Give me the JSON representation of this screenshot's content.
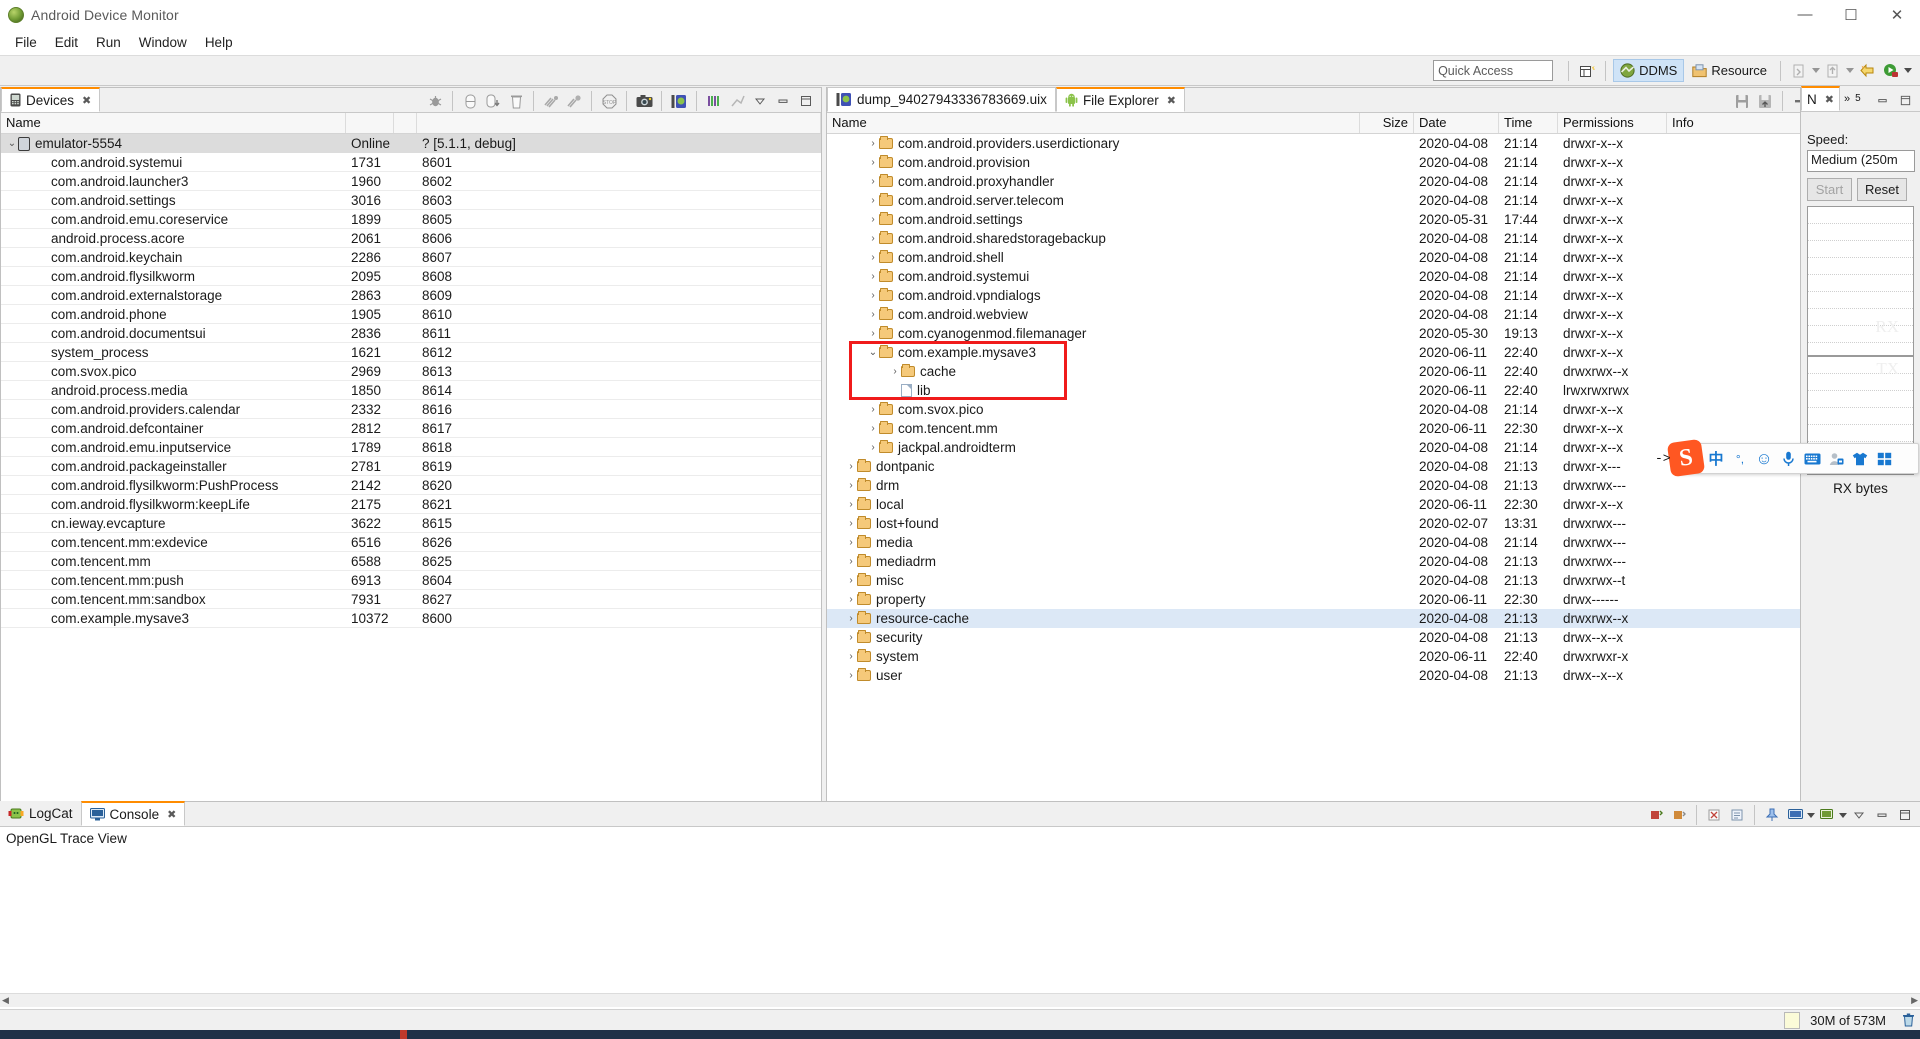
{
  "window": {
    "title": "Android Device Monitor",
    "icon": "android-logo-icon",
    "minimize": "—",
    "maximize": "☐",
    "close": "✕"
  },
  "menu": [
    "File",
    "Edit",
    "Run",
    "Window",
    "Help"
  ],
  "toolbar": {
    "quick_access_placeholder": "Quick Access",
    "new_perspective_icon": "new-perspective-icon",
    "perspectives": [
      {
        "label": "DDMS",
        "icon": "ddms-icon",
        "active": true
      },
      {
        "label": "Resource",
        "icon": "resource-icon",
        "active": false
      }
    ],
    "extra_icons": [
      "import-icon",
      "export-icon",
      "new-icon",
      "run-icon"
    ]
  },
  "devices_panel": {
    "tab": {
      "label": "Devices",
      "icon": "device-icon",
      "close": "✖"
    },
    "tools": [
      "debug-icon",
      "heap-icon",
      "heap-update-icon",
      "gc-icon",
      "threads-icon",
      "method-profiling-icon",
      "stop-icon",
      "screen-capture-icon",
      "device-dump-icon",
      "systrace-icon",
      "hierarchy-icon",
      "view-menu-icon",
      "minimize-icon",
      "maximize-icon"
    ],
    "columns": [
      "Name",
      "",
      "",
      ""
    ],
    "device": {
      "name": "emulator-5554",
      "status": "Online",
      "version": "? [5.1.1, debug]"
    },
    "processes": [
      {
        "name": "com.android.systemui",
        "pid": "1731",
        "port": "8601"
      },
      {
        "name": "com.android.launcher3",
        "pid": "1960",
        "port": "8602"
      },
      {
        "name": "com.android.settings",
        "pid": "3016",
        "port": "8603"
      },
      {
        "name": "com.android.emu.coreservice",
        "pid": "1899",
        "port": "8605"
      },
      {
        "name": "android.process.acore",
        "pid": "2061",
        "port": "8606"
      },
      {
        "name": "com.android.keychain",
        "pid": "2286",
        "port": "8607"
      },
      {
        "name": "com.android.flysilkworm",
        "pid": "2095",
        "port": "8608"
      },
      {
        "name": "com.android.externalstorage",
        "pid": "2863",
        "port": "8609"
      },
      {
        "name": "com.android.phone",
        "pid": "1905",
        "port": "8610"
      },
      {
        "name": "com.android.documentsui",
        "pid": "2836",
        "port": "8611"
      },
      {
        "name": "system_process",
        "pid": "1621",
        "port": "8612"
      },
      {
        "name": "com.svox.pico",
        "pid": "2969",
        "port": "8613"
      },
      {
        "name": "android.process.media",
        "pid": "1850",
        "port": "8614"
      },
      {
        "name": "com.android.providers.calendar",
        "pid": "2332",
        "port": "8616"
      },
      {
        "name": "com.android.defcontainer",
        "pid": "2812",
        "port": "8617"
      },
      {
        "name": "com.android.emu.inputservice",
        "pid": "1789",
        "port": "8618"
      },
      {
        "name": "com.android.packageinstaller",
        "pid": "2781",
        "port": "8619"
      },
      {
        "name": "com.android.flysilkworm:PushProcess",
        "pid": "2142",
        "port": "8620"
      },
      {
        "name": "com.android.flysilkworm:keepLife",
        "pid": "2175",
        "port": "8621"
      },
      {
        "name": "cn.ieway.evcapture",
        "pid": "3622",
        "port": "8615"
      },
      {
        "name": "com.tencent.mm:exdevice",
        "pid": "6516",
        "port": "8626"
      },
      {
        "name": "com.tencent.mm",
        "pid": "6588",
        "port": "8625"
      },
      {
        "name": "com.tencent.mm:push",
        "pid": "6913",
        "port": "8604"
      },
      {
        "name": "com.tencent.mm:sandbox",
        "pid": "7931",
        "port": "8627"
      },
      {
        "name": "com.example.mysave3",
        "pid": "10372",
        "port": "8600"
      }
    ]
  },
  "editor_tabs": [
    {
      "label": "dump_94027943336783669.uix",
      "icon": "uix-file-icon",
      "active": false,
      "close": ""
    },
    {
      "label": "File Explorer",
      "icon": "android-robot-icon",
      "active": true,
      "close": "✖"
    }
  ],
  "file_explorer": {
    "tools": [
      "pull-file-icon",
      "push-file-icon",
      "delete-icon",
      "new-folder-icon",
      "view-menu-icon",
      "minimize-icon",
      "maximize-icon"
    ],
    "columns": [
      "Name",
      "Size",
      "Date",
      "Time",
      "Permissions",
      "Info"
    ],
    "rows": [
      {
        "indent": 1,
        "twisty": "›",
        "icon": "folder",
        "name": "com.android.providers.userdictionary",
        "size": "",
        "date": "2020-04-08",
        "time": "21:14",
        "perm": "drwxr-x--x",
        "info": "",
        "selected": false
      },
      {
        "indent": 1,
        "twisty": "›",
        "icon": "folder",
        "name": "com.android.provision",
        "size": "",
        "date": "2020-04-08",
        "time": "21:14",
        "perm": "drwxr-x--x",
        "info": "",
        "selected": false
      },
      {
        "indent": 1,
        "twisty": "›",
        "icon": "folder",
        "name": "com.android.proxyhandler",
        "size": "",
        "date": "2020-04-08",
        "time": "21:14",
        "perm": "drwxr-x--x",
        "info": "",
        "selected": false
      },
      {
        "indent": 1,
        "twisty": "›",
        "icon": "folder",
        "name": "com.android.server.telecom",
        "size": "",
        "date": "2020-04-08",
        "time": "21:14",
        "perm": "drwxr-x--x",
        "info": "",
        "selected": false
      },
      {
        "indent": 1,
        "twisty": "›",
        "icon": "folder",
        "name": "com.android.settings",
        "size": "",
        "date": "2020-05-31",
        "time": "17:44",
        "perm": "drwxr-x--x",
        "info": "",
        "selected": false
      },
      {
        "indent": 1,
        "twisty": "›",
        "icon": "folder",
        "name": "com.android.sharedstoragebackup",
        "size": "",
        "date": "2020-04-08",
        "time": "21:14",
        "perm": "drwxr-x--x",
        "info": "",
        "selected": false
      },
      {
        "indent": 1,
        "twisty": "›",
        "icon": "folder",
        "name": "com.android.shell",
        "size": "",
        "date": "2020-04-08",
        "time": "21:14",
        "perm": "drwxr-x--x",
        "info": "",
        "selected": false
      },
      {
        "indent": 1,
        "twisty": "›",
        "icon": "folder",
        "name": "com.android.systemui",
        "size": "",
        "date": "2020-04-08",
        "time": "21:14",
        "perm": "drwxr-x--x",
        "info": "",
        "selected": false
      },
      {
        "indent": 1,
        "twisty": "›",
        "icon": "folder",
        "name": "com.android.vpndialogs",
        "size": "",
        "date": "2020-04-08",
        "time": "21:14",
        "perm": "drwxr-x--x",
        "info": "",
        "selected": false
      },
      {
        "indent": 1,
        "twisty": "›",
        "icon": "folder",
        "name": "com.android.webview",
        "size": "",
        "date": "2020-04-08",
        "time": "21:14",
        "perm": "drwxr-x--x",
        "info": "",
        "selected": false
      },
      {
        "indent": 1,
        "twisty": "›",
        "icon": "folder",
        "name": "com.cyanogenmod.filemanager",
        "size": "",
        "date": "2020-05-30",
        "time": "19:13",
        "perm": "drwxr-x--x",
        "info": "",
        "selected": false
      },
      {
        "indent": 1,
        "twisty": "⌄",
        "icon": "folder",
        "name": "com.example.mysave3",
        "size": "",
        "date": "2020-06-11",
        "time": "22:40",
        "perm": "drwxr-x--x",
        "info": "",
        "selected": false
      },
      {
        "indent": 2,
        "twisty": "›",
        "icon": "folder",
        "name": "cache",
        "size": "",
        "date": "2020-06-11",
        "time": "22:40",
        "perm": "drwxrwx--x",
        "info": "",
        "selected": false
      },
      {
        "indent": 2,
        "twisty": "",
        "icon": "file",
        "name": "lib",
        "size": "",
        "date": "2020-06-11",
        "time": "22:40",
        "perm": "lrwxrwxrwx",
        "info": "",
        "selected": false
      },
      {
        "indent": 1,
        "twisty": "›",
        "icon": "folder",
        "name": "com.svox.pico",
        "size": "",
        "date": "2020-04-08",
        "time": "21:14",
        "perm": "drwxr-x--x",
        "info": "",
        "selected": false
      },
      {
        "indent": 1,
        "twisty": "›",
        "icon": "folder",
        "name": "com.tencent.mm",
        "size": "",
        "date": "2020-06-11",
        "time": "22:30",
        "perm": "drwxr-x--x",
        "info": "",
        "selected": false
      },
      {
        "indent": 1,
        "twisty": "›",
        "icon": "folder",
        "name": "jackpal.androidterm",
        "size": "",
        "date": "2020-04-08",
        "time": "21:14",
        "perm": "drwxr-x--x",
        "info": "",
        "selected": false
      },
      {
        "indent": 0,
        "twisty": "›",
        "icon": "folder",
        "name": "dontpanic",
        "size": "",
        "date": "2020-04-08",
        "time": "21:13",
        "perm": "drwxr-x---",
        "info": "",
        "selected": false
      },
      {
        "indent": 0,
        "twisty": "›",
        "icon": "folder",
        "name": "drm",
        "size": "",
        "date": "2020-04-08",
        "time": "21:13",
        "perm": "drwxrwx---",
        "info": "",
        "selected": false
      },
      {
        "indent": 0,
        "twisty": "›",
        "icon": "folder",
        "name": "local",
        "size": "",
        "date": "2020-06-11",
        "time": "22:30",
        "perm": "drwxr-x--x",
        "info": "",
        "selected": false
      },
      {
        "indent": 0,
        "twisty": "›",
        "icon": "folder",
        "name": "lost+found",
        "size": "",
        "date": "2020-02-07",
        "time": "13:31",
        "perm": "drwxrwx---",
        "info": "",
        "selected": false
      },
      {
        "indent": 0,
        "twisty": "›",
        "icon": "folder",
        "name": "media",
        "size": "",
        "date": "2020-04-08",
        "time": "21:14",
        "perm": "drwxrwx---",
        "info": "",
        "selected": false
      },
      {
        "indent": 0,
        "twisty": "›",
        "icon": "folder",
        "name": "mediadrm",
        "size": "",
        "date": "2020-04-08",
        "time": "21:13",
        "perm": "drwxrwx---",
        "info": "",
        "selected": false
      },
      {
        "indent": 0,
        "twisty": "›",
        "icon": "folder",
        "name": "misc",
        "size": "",
        "date": "2020-04-08",
        "time": "21:13",
        "perm": "drwxrwx--t",
        "info": "",
        "selected": false
      },
      {
        "indent": 0,
        "twisty": "›",
        "icon": "folder",
        "name": "property",
        "size": "",
        "date": "2020-06-11",
        "time": "22:30",
        "perm": "drwx------",
        "info": "",
        "selected": false
      },
      {
        "indent": 0,
        "twisty": "›",
        "icon": "folder",
        "name": "resource-cache",
        "size": "",
        "date": "2020-04-08",
        "time": "21:13",
        "perm": "drwxrwx--x",
        "info": "",
        "selected": true
      },
      {
        "indent": 0,
        "twisty": "›",
        "icon": "folder",
        "name": "security",
        "size": "",
        "date": "2020-04-08",
        "time": "21:13",
        "perm": "drwx--x--x",
        "info": "",
        "selected": false
      },
      {
        "indent": 0,
        "twisty": "›",
        "icon": "folder",
        "name": "system",
        "size": "",
        "date": "2020-06-11",
        "time": "22:40",
        "perm": "drwxrwxr-x",
        "info": "",
        "selected": false
      },
      {
        "indent": 0,
        "twisty": "›",
        "icon": "folder",
        "name": "user",
        "size": "",
        "date": "2020-04-08",
        "time": "21:13",
        "perm": "drwx--x--x",
        "info": "",
        "selected": false
      }
    ],
    "highlight_note": "red-rectangle-around-mysave3"
  },
  "network_panel": {
    "tabs": [
      {
        "label": "N",
        "icon": "network-icon",
        "close": "✖",
        "active": true
      },
      {
        "label": "»",
        "badge": "5",
        "active": false
      }
    ],
    "speed_label": "Speed:",
    "speed_value": "Medium (250m",
    "start_button": "Start",
    "reset_button": "Reset",
    "graph_rx_watermark": "RX",
    "graph_tx_watermark": "TX",
    "footer_label": "RX bytes"
  },
  "bottom_panel": {
    "tabs": [
      {
        "label": "LogCat",
        "icon": "logcat-icon",
        "active": false,
        "close": ""
      },
      {
        "label": "Console",
        "icon": "console-icon",
        "active": true,
        "close": "✖"
      }
    ],
    "tools": [
      "terminate-icon",
      "remove-launch-icon",
      "clear-icon",
      "scroll-lock-icon",
      "pin-icon",
      "display-selected-icon",
      "open-console-icon",
      "view-menu-icon",
      "minimize-icon",
      "maximize-icon"
    ],
    "content": "OpenGL Trace View"
  },
  "status_bar": {
    "heap": "30M of 573M",
    "trash_icon": "trash-icon"
  },
  "ime_bar": {
    "name": "sogou-input-method",
    "logo": "S",
    "arrow": "->",
    "buttons": [
      {
        "name": "language-toggle",
        "glyph": "中"
      },
      {
        "name": "punctuation-toggle",
        "glyph": "°,"
      },
      {
        "name": "emoji-icon",
        "glyph": "☺"
      },
      {
        "name": "voice-input-icon",
        "glyph": "🎙"
      },
      {
        "name": "soft-keyboard-icon",
        "glyph": "⌨"
      },
      {
        "name": "user-account-icon",
        "glyph": "👤"
      },
      {
        "name": "skin-icon",
        "glyph": "👕"
      },
      {
        "name": "toolbox-icon",
        "glyph": "▦"
      }
    ]
  }
}
